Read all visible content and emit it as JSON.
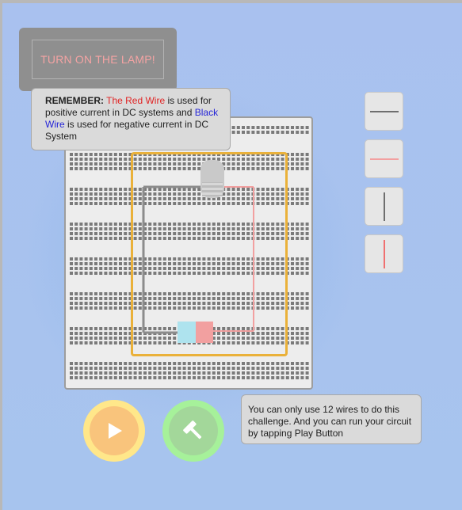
{
  "challenge": {
    "title": "TURN ON THE LAMP!"
  },
  "remember_note": {
    "label": "REMEMBER:",
    "red_wire": "The Red Wire",
    "text1": " is used for positive current in DC systems and ",
    "black_wire": "Black Wire",
    "text2": " is used for negative current in DC System"
  },
  "info_note": {
    "text": "You can only use 12 wires to do this challenge. And you can run your circuit by tapping Play Button"
  },
  "toolbox": {
    "items": [
      {
        "name": "horizontal-black-wire-icon",
        "color": "#6e6e6e"
      },
      {
        "name": "horizontal-red-wire-icon",
        "color": "#f2a0a0"
      },
      {
        "name": "vertical-black-wire-icon",
        "color": "#6e6e6e"
      },
      {
        "name": "vertical-red-wire-icon",
        "color": "#f07070"
      }
    ]
  },
  "buttons": {
    "play": {
      "icon": "play-icon"
    },
    "build": {
      "icon": "hammer-icon"
    }
  },
  "colors": {
    "highlight": "#eab13a",
    "red_wire": "#f2a0a0",
    "black_wire": "#8c8c8c",
    "battery_positive": "#f2a0a0",
    "battery_negative": "#aee3ee"
  }
}
